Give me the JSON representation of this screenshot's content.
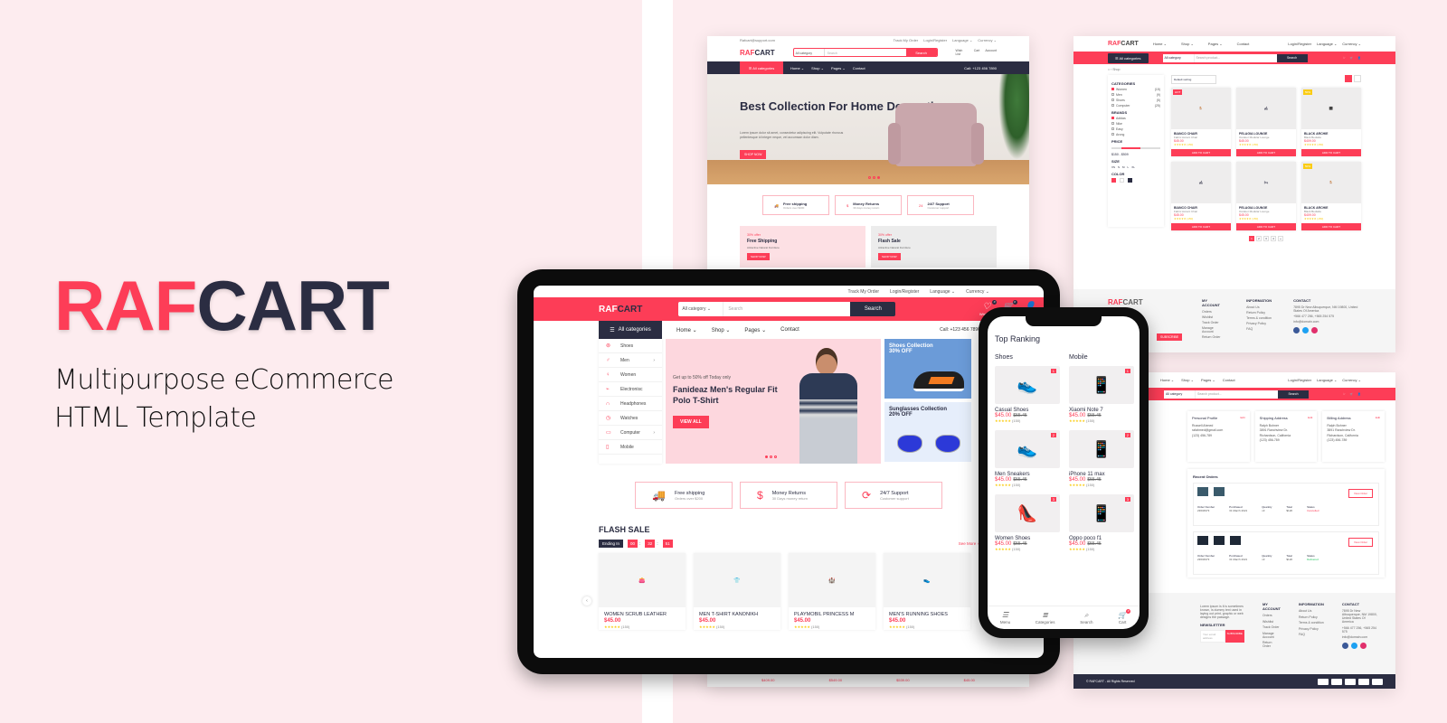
{
  "brand": {
    "raf": "RAF",
    "cart": "CART"
  },
  "tagline": {
    "line1": "Multipurpose eCommerce",
    "line2": "HTML Template"
  },
  "colors": {
    "accent": "#fd3d57",
    "dark": "#2b2d42",
    "background": "#fdecef"
  },
  "tablet": {
    "topbar": [
      "Track My Order",
      "Login/Register",
      "Language ⌄",
      "Currency ⌄"
    ],
    "logo": {
      "raf": "RAF",
      "cart": "CART"
    },
    "search": {
      "category": "All category ⌄",
      "placeholder": "Search",
      "button": "Search"
    },
    "header_icons": [
      {
        "label": "Wish List",
        "badge": "0"
      },
      {
        "label": "Cart",
        "badge": "0"
      },
      {
        "label": "Account",
        "badge": ""
      }
    ],
    "nav": {
      "all_categories": "All categories",
      "links": [
        "Home ⌄",
        "Shop ⌄",
        "Pages ⌄",
        "Contact"
      ],
      "call": "Call: +123 456 7890"
    },
    "categories": [
      {
        "label": "Shoes",
        "sub": false
      },
      {
        "label": "Men",
        "sub": true
      },
      {
        "label": "Women",
        "sub": false
      },
      {
        "label": "Electronisc",
        "sub": false
      },
      {
        "label": "Headphones",
        "sub": false
      },
      {
        "label": "Watches",
        "sub": false
      },
      {
        "label": "Computer",
        "sub": true
      },
      {
        "label": "Mobile",
        "sub": false
      }
    ],
    "hero": {
      "eyebrow": "Get up to 50% off Today only",
      "title": "Fanideaz Men's Regular Fit Polo T-Shirt",
      "button": "VIEW ALL"
    },
    "side_banners": [
      {
        "title": "Shoes Collection",
        "discount": "30% OFF"
      },
      {
        "title": "Sunglasses Collection",
        "discount": "20% OFF"
      }
    ],
    "features": [
      {
        "title": "Free shipping",
        "sub": "Orders over $200"
      },
      {
        "title": "Money Returns",
        "sub": "30 Days money return"
      },
      {
        "title": "24/7 Support",
        "sub": "Customer support"
      }
    ],
    "flash_sale": {
      "title": "FLASH SALE",
      "ending_label": "Ending In",
      "hours": "00",
      "minutes": "32",
      "seconds": "51",
      "see_more": "See More ›"
    },
    "products": [
      {
        "name": "WOMEN SCRUB LEATHER",
        "price": "$45.00",
        "reviews": "(150)"
      },
      {
        "name": "MEN T-SHIRT KANONIKH",
        "price": "$45.00",
        "reviews": "(150)"
      },
      {
        "name": "PLAYMOBIL PRINCESS M",
        "price": "$45.00",
        "reviews": "(150)"
      },
      {
        "name": "MEN'S RUNNING SHOES",
        "price": "$45.00",
        "reviews": "(150)"
      }
    ]
  },
  "phone": {
    "title": "Top Ranking",
    "columns": [
      {
        "heading": "Shoes",
        "items": [
          {
            "rank": "1",
            "name": "Casual Shoes",
            "price": "$45.00",
            "old": "$55.45",
            "reviews": "(150)"
          },
          {
            "rank": "2",
            "name": "Men Sneakers",
            "price": "$45.00",
            "old": "$55.45",
            "reviews": "(150)"
          },
          {
            "rank": "3",
            "name": "Women Shoes",
            "price": "$45.00",
            "old": "$55.45",
            "reviews": "(150)"
          }
        ]
      },
      {
        "heading": "Mobile",
        "items": [
          {
            "rank": "1",
            "name": "Xiaomi Note 7",
            "price": "$45.00",
            "old": "$55.45",
            "reviews": "(150)"
          },
          {
            "rank": "2",
            "name": "iPhone 11 max",
            "price": "$45.00",
            "old": "$55.45",
            "reviews": "(150)"
          },
          {
            "rank": "3",
            "name": "Oppo poco f1",
            "price": "$45.00",
            "old": "$55.45",
            "reviews": "(150)"
          }
        ]
      }
    ],
    "tabbar": [
      {
        "label": "Menu",
        "icon": "☰"
      },
      {
        "label": "Categories",
        "icon": "≣"
      },
      {
        "label": "Search",
        "icon": "⌕"
      },
      {
        "label": "Cart",
        "icon": "🛒",
        "badge": "0"
      }
    ]
  },
  "home": {
    "topbar": {
      "email": "Rafcart@support.com",
      "links": [
        "Track My Order",
        "Login/Register",
        "Language ⌄",
        "Currency ⌄"
      ]
    },
    "search": {
      "category": "All category",
      "placeholder": "Search",
      "button": "Search"
    },
    "icons": [
      "Wish List",
      "Cart",
      "Account"
    ],
    "nav": {
      "all_categories": "☰ All categories",
      "links": [
        "Home ⌄",
        "Shop ⌄",
        "Pages ⌄",
        "Contact"
      ],
      "call": "Call: +123 456 7890"
    },
    "hero": {
      "title": "Best Collection For Home Decoration",
      "text": "Lorem ipsum dolor sit amet, consectetur adipiscing elit. Vulputate rhoncus pellentesque id integer neque, vel accumsan dolor diam.",
      "button": "SHOP NOW"
    },
    "features": [
      {
        "title": "Free shipping",
        "sub": "Orders over $200"
      },
      {
        "title": "Money Returns",
        "sub": "30 days money return"
      },
      {
        "title": "24/7 Support",
        "sub": "Customer support"
      }
    ],
    "promos": [
      {
        "offer": "30% offer",
        "title": "Free Shipping",
        "sub": "Attractive Natural Furniture",
        "button": "SHOP NOW"
      },
      {
        "offer": "30% offer",
        "title": "Flash Sale",
        "sub": "Attractive Natural Furniture",
        "button": "SHOP NOW"
      }
    ],
    "bottom_prices": [
      "$409.00",
      "$549.00",
      "$539.00",
      "$45.00"
    ]
  },
  "shop": {
    "nav": [
      "Home ⌄",
      "Shop ⌄",
      "Pages ⌄",
      "Contact"
    ],
    "right": [
      "Login/Register",
      "Language ⌄",
      "Currency ⌄"
    ],
    "all_categories": "☰ All categories",
    "search": {
      "category": "All category",
      "placeholder": "Search product...",
      "button": "Search"
    },
    "breadcrumb": "⌂ › Shop",
    "categories_title": "CATEGORIES",
    "categories": [
      {
        "label": "Women",
        "count": "(15)",
        "checked": true
      },
      {
        "label": "Men",
        "count": "(9)",
        "checked": false
      },
      {
        "label": "Shoes",
        "count": "(5)",
        "checked": false
      },
      {
        "label": "Computer",
        "count": "(25)",
        "checked": false
      }
    ],
    "brands_title": "BRANDS",
    "brands": [
      {
        "label": "Adidas",
        "checked": true
      },
      {
        "label": "Nike",
        "checked": false
      },
      {
        "label": "Easy",
        "checked": false
      },
      {
        "label": "Arong",
        "checked": false
      }
    ],
    "price_title": "PRICE",
    "price_range": "$150 - $509",
    "size_title": "SIZE",
    "sizes": [
      "XS",
      "S",
      "M",
      "L",
      "XL"
    ],
    "color_title": "COLOR",
    "sort": "Default sorting",
    "products": [
      {
        "tag": "HOT",
        "name": "BIANCO CHAIR",
        "sub": "Fabric Accent Chair",
        "price": "$45.00",
        "reviews": "(150)"
      },
      {
        "tag": "",
        "name": "PELAGIA LOUNGE",
        "sub": "Outdoor Modular Lounge",
        "price": "$45.00",
        "reviews": "(150)"
      },
      {
        "tag": "50%",
        "name": "BLACK ARCHIE",
        "sub": "Black Bedside",
        "price": "$409.00",
        "reviews": "(150)"
      },
      {
        "tag": "",
        "name": "BIANCO CHAIR",
        "sub": "Fabric Accent Chair",
        "price": "$45.00",
        "reviews": "(150)"
      },
      {
        "tag": "",
        "name": "PELAGIA LOUNGE",
        "sub": "Outdoor Modular Lounge",
        "price": "$45.00",
        "reviews": "(150)"
      },
      {
        "tag": "50%",
        "name": "BLACK ARCHIE",
        "sub": "Black Bedside",
        "price": "$409.00",
        "reviews": "(150)"
      }
    ],
    "add_to_cart": "ADD TO CART",
    "pages": [
      "1",
      "2",
      "3",
      "4",
      "»"
    ],
    "footer": {
      "subscribe": "SUBSCRIBE",
      "my_account": {
        "title": "MY ACCOUNT",
        "links": [
          "Orders",
          "Wishlist",
          "Track Order",
          "Manage Account",
          "Return Order"
        ]
      },
      "information": {
        "title": "INFORMATION",
        "links": [
          "About Us",
          "Return Policy",
          "Terms & condition",
          "Privacy Policy",
          "FAQ"
        ]
      },
      "contact": {
        "title": "CONTACT",
        "address": "7895 Dr New Albuquerque, NM 19800, United States Of America",
        "phone": "+566 477 256, +565 254 575",
        "email": "info@domain.com"
      }
    }
  },
  "account": {
    "nav": [
      "Home ⌄",
      "Shop ⌄",
      "Pages ⌄",
      "Contact"
    ],
    "right": [
      "Login/Register",
      "Language ⌄",
      "Currency ⌄"
    ],
    "search": {
      "category": "All category",
      "placeholder": "Search product...",
      "button": "Search"
    },
    "cards": [
      {
        "title": "Personal Profile",
        "edit": "Edit",
        "lines": [
          "Russell Ahmed",
          "rafahmed@gmail.com",
          "(123) 456-789"
        ]
      },
      {
        "title": "Shipping Address",
        "edit": "Edit",
        "lines": [
          "Ralph Bohner",
          "3891 Ranchview Dr.",
          "Richardson, California",
          "(123) 456-789"
        ]
      },
      {
        "title": "Billing Address",
        "edit": "Edit",
        "lines": [
          "Ralph Bohner",
          "3891 Ranchview Dr.",
          "Richardson, California",
          "(123) 456-789"
        ]
      }
    ],
    "recent_orders_title": "Recent Orders",
    "orders": [
      {
        "number": "23634973",
        "purchased": "31 March 2021",
        "quantity": "x3",
        "total": "$120",
        "status": "Cancelled",
        "status_color": "#fd3d57",
        "button": "View Order"
      },
      {
        "number": "23634973",
        "purchased": "31 March 2021",
        "quantity": "x3",
        "total": "$120",
        "status": "Delivered",
        "status_color": "#22c55e",
        "button": "View Order"
      }
    ],
    "order_headers": [
      "Order Number",
      "Purchased",
      "Quantity",
      "Total",
      "Status"
    ],
    "footer": {
      "about": "Lorem ipsum is it is sometimes known, is dummy text used in laying out print, graphic or web designs the passage.",
      "newsletter_title": "NEWSLETTER",
      "email_placeholder": "Your email address",
      "subscribe": "SUBSCRIBE",
      "my_account": {
        "title": "MY ACCOUNT",
        "links": [
          "Orders",
          "Wishlist",
          "Track Order",
          "Manage Account",
          "Return Order"
        ]
      },
      "information": {
        "title": "INFORMATION",
        "links": [
          "About Us",
          "Return Policy",
          "Terms & condition",
          "Privacy Policy",
          "FAQ"
        ]
      },
      "contact": {
        "title": "CONTACT",
        "address": "7895 Dr New Albuquerque, NM 19800, United States Of America",
        "phone": "+566 477 256, +565 254 575",
        "email": "info@domain.com"
      },
      "copyright": "© RAFCART - All Rights Reserved"
    }
  }
}
